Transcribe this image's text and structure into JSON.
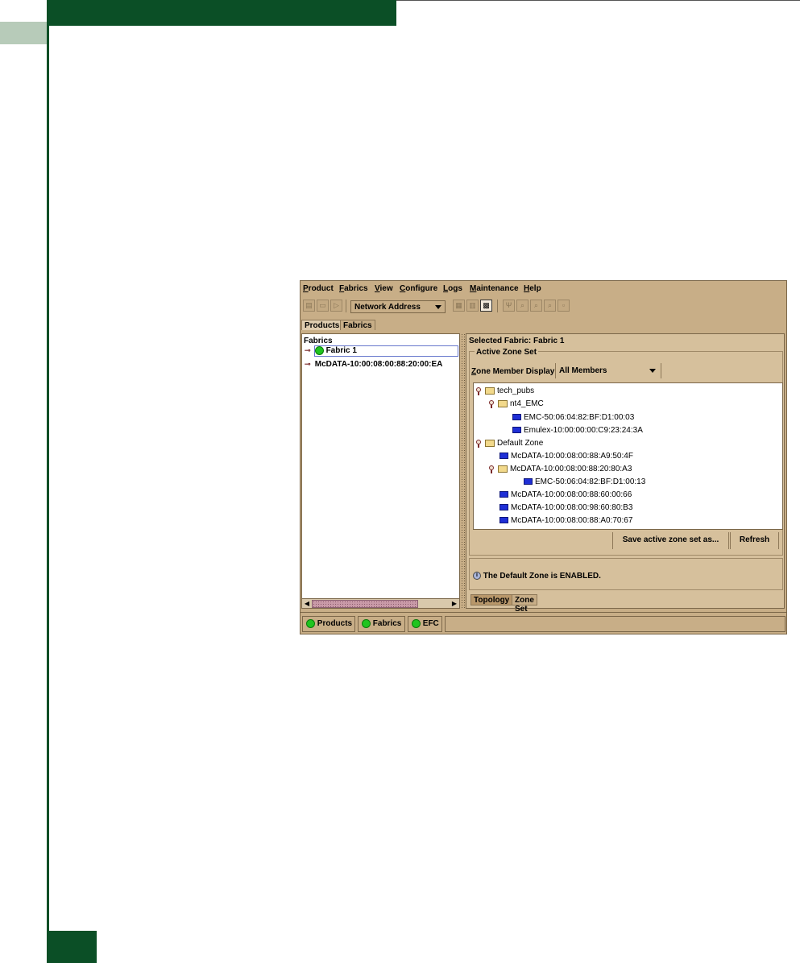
{
  "menu": [
    "Product",
    "Fabrics",
    "View",
    "Configure",
    "Logs",
    "Maintenance",
    "Help"
  ],
  "toolbar": {
    "address_combo": "Network Address",
    "icons": [
      "new-icon",
      "open-icon",
      "export-icon",
      "save-icon",
      "delete-icon",
      "properties-icon",
      "topology-icon",
      "zoom-in-icon",
      "zoom-out-icon",
      "zoom-fit-icon",
      "reset-icon"
    ]
  },
  "tabs_top": [
    "Products",
    "Fabrics"
  ],
  "left_pane": {
    "title": "Fabrics",
    "items": [
      "Fabric 1",
      "McDATA-10:00:08:00:88:20:00:EA"
    ]
  },
  "right_pane": {
    "selected_fabric": "Selected Fabric: Fabric 1",
    "group_title": "Active Zone Set",
    "member_display_label": "Zone Member Display",
    "member_display_value": "All Members",
    "tree": [
      {
        "label": "tech_pubs",
        "type": "zone",
        "level": 0
      },
      {
        "label": "nt4_EMC",
        "type": "zone",
        "level": 1
      },
      {
        "label": "EMC-50:06:04:82:BF:D1:00:03",
        "type": "member",
        "level": 2
      },
      {
        "label": "Emulex-10:00:00:00:C9:23:24:3A",
        "type": "member",
        "level": 2
      },
      {
        "label": "Default Zone",
        "type": "zone",
        "level": 0
      },
      {
        "label": "McDATA-10:00:08:00:88:A9:50:4F",
        "type": "member",
        "level": 1
      },
      {
        "label": "McDATA-10:00:08:00:88:20:80:A3",
        "type": "zone",
        "level": 1
      },
      {
        "label": "EMC-50:06:04:82:BF:D1:00:13",
        "type": "member",
        "level": 2
      },
      {
        "label": "McDATA-10:00:08:00:88:60:00:66",
        "type": "member",
        "level": 1
      },
      {
        "label": "McDATA-10:00:08:00:98:60:80:B3",
        "type": "member",
        "level": 1
      },
      {
        "label": "McDATA-10:00:08:00:88:A0:70:67",
        "type": "member",
        "level": 1
      }
    ],
    "save_button": "Save active zone set as...",
    "refresh_button": "Refresh",
    "message": "The Default Zone is ENABLED."
  },
  "tabs_bottom": [
    "Topology",
    "Zone Set"
  ],
  "statusbar": [
    "Products",
    "Fabrics",
    "EFC"
  ]
}
